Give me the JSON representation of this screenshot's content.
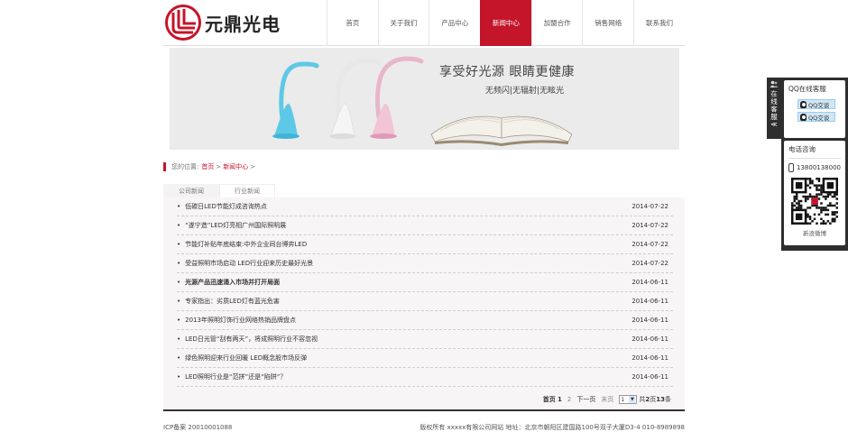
{
  "brand": {
    "name": "元鼎光电",
    "accent": "#c4152b"
  },
  "nav": {
    "items": [
      {
        "label": "首页",
        "active": false
      },
      {
        "label": "关于我们",
        "active": false
      },
      {
        "label": "产品中心",
        "active": false
      },
      {
        "label": "新闻中心",
        "active": true
      },
      {
        "label": "加盟合作",
        "active": false
      },
      {
        "label": "销售网络",
        "active": false
      },
      {
        "label": "联系我们",
        "active": false
      }
    ]
  },
  "banner": {
    "title": "享受好光源 眼睛更健康",
    "subtitle": "无频闪|无辐射|无眩光"
  },
  "breadcrumb": {
    "prefix": "您的位置:",
    "items": [
      "首页",
      "新闻中心"
    ],
    "sep": ">"
  },
  "tabs": [
    {
      "label": "公司新闻",
      "active": true
    },
    {
      "label": "行业新闻",
      "active": false
    }
  ],
  "news": [
    {
      "title": "低碳日LED节能灯成咨询热点",
      "date": "2014-07-22",
      "bold": false
    },
    {
      "title": "“遂宁造”LED灯亮相广州国际照明展",
      "date": "2014-07-22",
      "bold": false
    },
    {
      "title": "节能灯补贴年底结束:中外企业同台博弈LED",
      "date": "2014-07-22",
      "bold": false
    },
    {
      "title": "受益照明市场启动 LED行业迎来历史最好光景",
      "date": "2014-07-22",
      "bold": false
    },
    {
      "title": "光源产品迅速涌入市场并打开局面",
      "date": "2014-06-11",
      "bold": true
    },
    {
      "title": "专家指出：劣质LED灯有蓝光危害",
      "date": "2014-06-11",
      "bold": false
    },
    {
      "title": "2013年照明灯饰行业网络热销品牌盘点",
      "date": "2014-06-11",
      "bold": false
    },
    {
      "title": "LED日光管“刮有两天”，将成照明行业不容忽视",
      "date": "2014-06-11",
      "bold": false
    },
    {
      "title": "绿色照明迎来行业回暖 LED概念股市场反弹",
      "date": "2014-06-11",
      "bold": false
    },
    {
      "title": "LED照明行业是“范拼”还是“陷阱”？",
      "date": "2014-06-11",
      "bold": false
    }
  ],
  "pager": {
    "first": "首页",
    "current": "1",
    "next_num": "2",
    "next": "下一页",
    "last": "末页",
    "select_value": "1",
    "total_prefix": "共",
    "total_pages": "2",
    "page_word": "页",
    "total_items": "13",
    "item_word": "条"
  },
  "footer": {
    "icp": "ICP备案 20010001088",
    "info": "版权所有 xxxxx有限公司网站 地址：北京市朝阳区建国路100号双子大厦D3-4 010-8989898"
  },
  "side": {
    "handle_label": "在线客服",
    "handle_arrow": "≪",
    "qq_title": "QQ在线客服",
    "qq_buttons": [
      "QQ交谈",
      "QQ交谈"
    ],
    "tel_title": "电话咨询",
    "tel_number": "13800138000",
    "qr_caption": "新浪微博"
  }
}
